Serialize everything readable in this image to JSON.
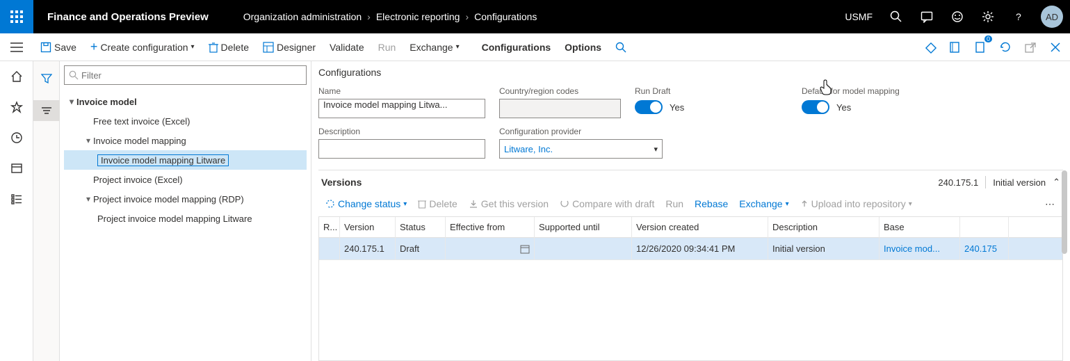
{
  "header": {
    "app_title": "Finance and Operations Preview",
    "breadcrumb": [
      "Organization administration",
      "Electronic reporting",
      "Configurations"
    ],
    "company": "USMF",
    "avatar": "AD"
  },
  "actionbar": {
    "save": "Save",
    "create": "Create configuration",
    "delete": "Delete",
    "designer": "Designer",
    "validate": "Validate",
    "run": "Run",
    "exchange": "Exchange",
    "configurations": "Configurations",
    "options": "Options"
  },
  "filter": {
    "placeholder": "Filter"
  },
  "tree": {
    "items": [
      {
        "label": "Invoice model",
        "level": 0,
        "expanded": true
      },
      {
        "label": "Free text invoice (Excel)",
        "level": 1
      },
      {
        "label": "Invoice model mapping",
        "level": 1,
        "expanded": true
      },
      {
        "label": "Invoice model mapping Litware",
        "level": 2,
        "selected": true
      },
      {
        "label": "Project invoice (Excel)",
        "level": 1
      },
      {
        "label": "Project invoice model mapping (RDP)",
        "level": 1,
        "expanded": true
      },
      {
        "label": "Project invoice model mapping Litware",
        "level": 2
      }
    ]
  },
  "details": {
    "heading": "Configurations",
    "labels": {
      "name": "Name",
      "country": "Country/region codes",
      "run_draft": "Run Draft",
      "default_mapping": "Default for model mapping",
      "description": "Description",
      "provider": "Configuration provider"
    },
    "values": {
      "name": "Invoice model mapping Litwa...",
      "country": "",
      "description": "",
      "provider": "Litware, Inc.",
      "run_draft": "Yes",
      "default_mapping": "Yes"
    }
  },
  "versions": {
    "heading": "Versions",
    "summary_version": "240.175.1",
    "summary_desc": "Initial version",
    "toolbar": {
      "change_status": "Change status",
      "delete": "Delete",
      "get_this": "Get this version",
      "compare": "Compare with draft",
      "run": "Run",
      "rebase": "Rebase",
      "exchange": "Exchange",
      "upload": "Upload into repository"
    },
    "columns": {
      "r": "R...",
      "version": "Version",
      "status": "Status",
      "effective": "Effective from",
      "supported": "Supported until",
      "created": "Version created",
      "description": "Description",
      "base": "Base"
    },
    "rows": [
      {
        "r": "",
        "version": "240.175.1",
        "status": "Draft",
        "effective": "",
        "supported": "",
        "created": "12/26/2020 09:34:41 PM",
        "description": "Initial version",
        "base_name": "Invoice mod...",
        "base_ver": "240.175"
      }
    ]
  }
}
